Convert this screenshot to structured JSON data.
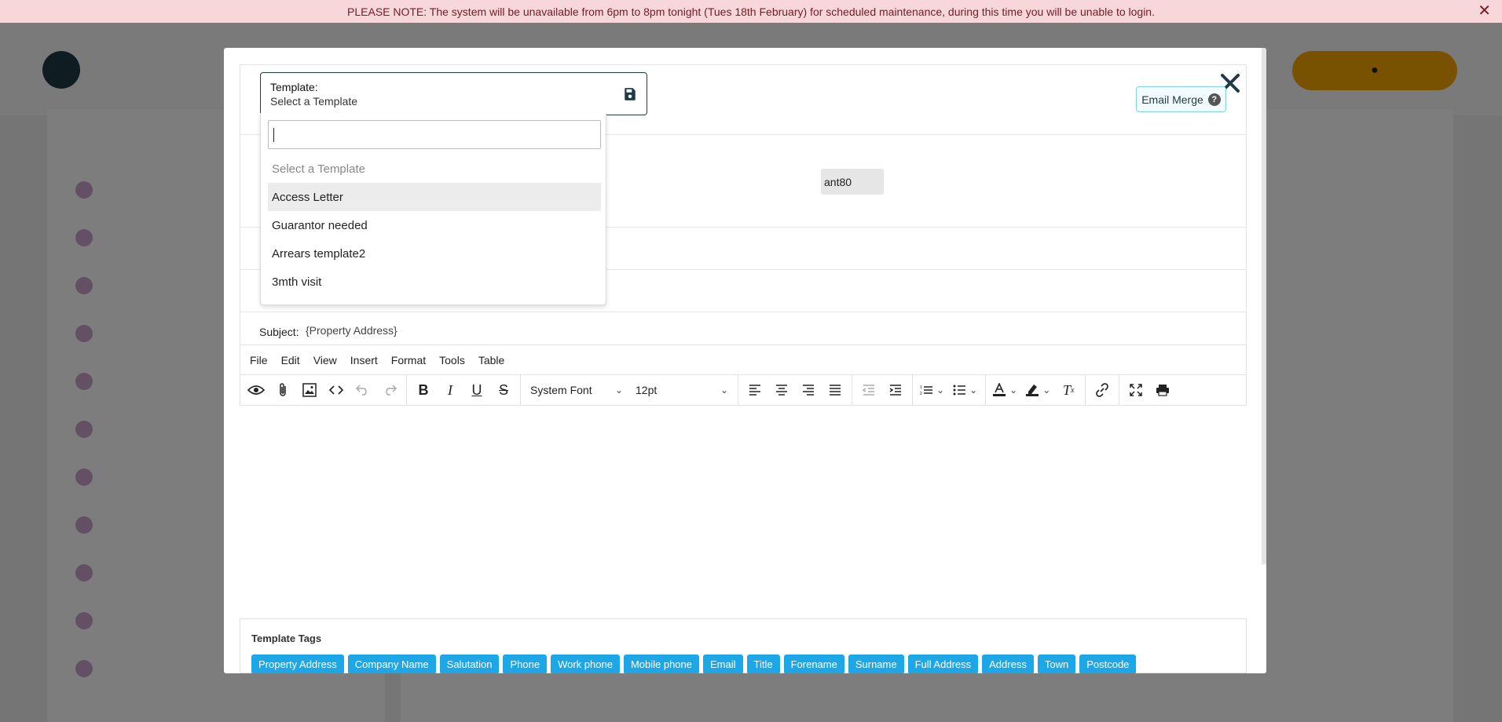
{
  "banner": {
    "message": "PLEASE NOTE: The system will be unavailable from 6pm to 8pm tonight (Tues 18th February) for scheduled maintenance, during this time you will be unable to login.",
    "close_glyph": "✕"
  },
  "modal": {
    "template": {
      "label": "Template:",
      "value": "Select a Template",
      "search_value": "",
      "options": [
        {
          "label": "Select a Template",
          "placeholder": true
        },
        {
          "label": "Access Letter",
          "highlighted": true
        },
        {
          "label": "Guarantor needed"
        },
        {
          "label": "Arrears template2"
        },
        {
          "label": "3mth visit"
        }
      ]
    },
    "email_merge": {
      "label": "Email Merge",
      "help_glyph": "?"
    },
    "recipient_tag": "ant80",
    "subject": {
      "label": "Subject:",
      "value": "{Property Address}"
    },
    "editor": {
      "menu": [
        "File",
        "Edit",
        "View",
        "Insert",
        "Format",
        "Tools",
        "Table"
      ],
      "font_family": "System Font",
      "font_size": "12pt",
      "toolbar_icons": [
        "preview-icon",
        "attachment-icon",
        "image-icon",
        "code-icon",
        "undo-icon",
        "redo-icon",
        "bold-icon",
        "italic-icon",
        "underline-icon",
        "strikethrough-icon",
        "align-left-icon",
        "align-center-icon",
        "align-right-icon",
        "justify-icon",
        "outdent-icon",
        "indent-icon",
        "numbered-list-icon",
        "bullet-list-icon",
        "text-color-icon",
        "highlight-icon",
        "clear-format-icon",
        "link-icon",
        "fullscreen-icon",
        "print-icon"
      ],
      "content": ""
    },
    "template_tags": {
      "title": "Template Tags",
      "tags": [
        "Property Address",
        "Company Name",
        "Salutation",
        "Phone",
        "Work phone",
        "Mobile phone",
        "Email",
        "Title",
        "Forename",
        "Surname",
        "Full Address",
        "Address",
        "Town",
        "Postcode"
      ]
    }
  },
  "colors": {
    "tag_bg": "#1ea7e6",
    "banner_bg": "#f8d7da",
    "banner_text": "#721c24",
    "brand_dark": "#1f3b45",
    "accent": "#f0a500"
  }
}
